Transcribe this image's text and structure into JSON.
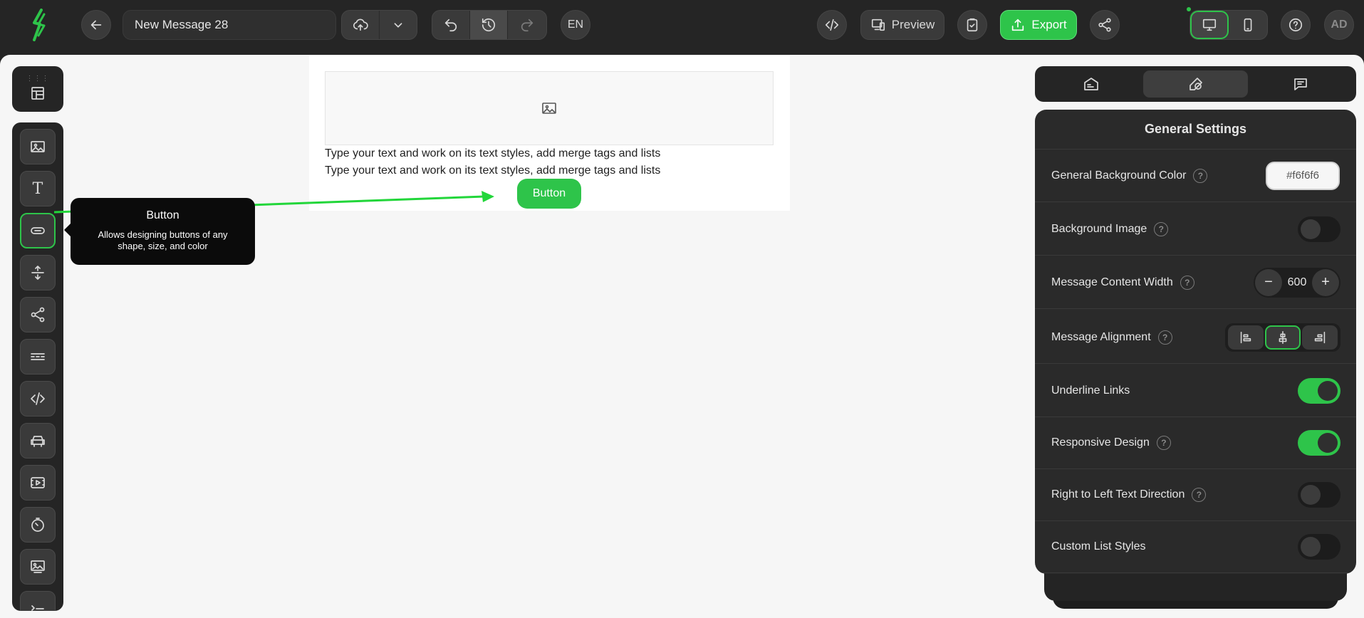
{
  "app": {
    "logo_icon": "lightning-logo-icon",
    "accent_color": "#2ec44a"
  },
  "header": {
    "message_title": "New Message 28",
    "language": "EN",
    "preview_label": "Preview",
    "export_label": "Export",
    "avatar_initials": "AD",
    "icons": [
      "back-arrow-icon",
      "cloud-upload-icon",
      "chevron-down-icon",
      "undo-icon",
      "history-icon",
      "redo-icon",
      "code-icon",
      "devices-icon",
      "clipboard-check-icon",
      "upload-icon",
      "share-icon",
      "desktop-icon",
      "mobile-icon",
      "help-icon"
    ]
  },
  "tooltip": {
    "title": "Button",
    "description": "Allows designing buttons of any shape, size, and color"
  },
  "message": {
    "text_line_1": "Type your text and work on its text styles, add merge tags and lists",
    "text_line_2": "Type your text and work on its text styles, add merge tags and lists",
    "button_label": "Button"
  },
  "tools": [
    {
      "name": "image-tool",
      "icon": "image-icon"
    },
    {
      "name": "text-tool",
      "icon": "text-icon",
      "glyph": "T"
    },
    {
      "name": "button-tool",
      "icon": "button-icon"
    },
    {
      "name": "spacer-tool",
      "icon": "spacer-icon"
    },
    {
      "name": "social-tool",
      "icon": "share-icon"
    },
    {
      "name": "divider-tool",
      "icon": "divider-icon"
    },
    {
      "name": "html-tool",
      "icon": "code-icon"
    },
    {
      "name": "menu-tool",
      "icon": "menu-icon"
    },
    {
      "name": "video-tool",
      "icon": "video-icon"
    },
    {
      "name": "timer-tool",
      "icon": "timer-icon"
    },
    {
      "name": "banner-tool",
      "icon": "banner-icon"
    },
    {
      "name": "list-tool",
      "icon": "list-icon"
    }
  ],
  "panel": {
    "tabs": [
      "content-tab-icon",
      "styles-tab-icon",
      "comments-tab-icon"
    ],
    "title": "General Settings",
    "settings": {
      "bg_color_label": "General Background Color",
      "bg_color_value": "#f6f6f6",
      "bg_image_label": "Background Image",
      "content_width_label": "Message Content Width",
      "content_width_value": "600",
      "alignment_label": "Message Alignment",
      "underline_label": "Underline Links",
      "underline_on": true,
      "responsive_label": "Responsive Design",
      "responsive_on": true,
      "rtl_label": "Right to Left Text Direction",
      "rtl_on": false,
      "custom_list_label": "Custom List Styles",
      "custom_list_on": false
    }
  }
}
